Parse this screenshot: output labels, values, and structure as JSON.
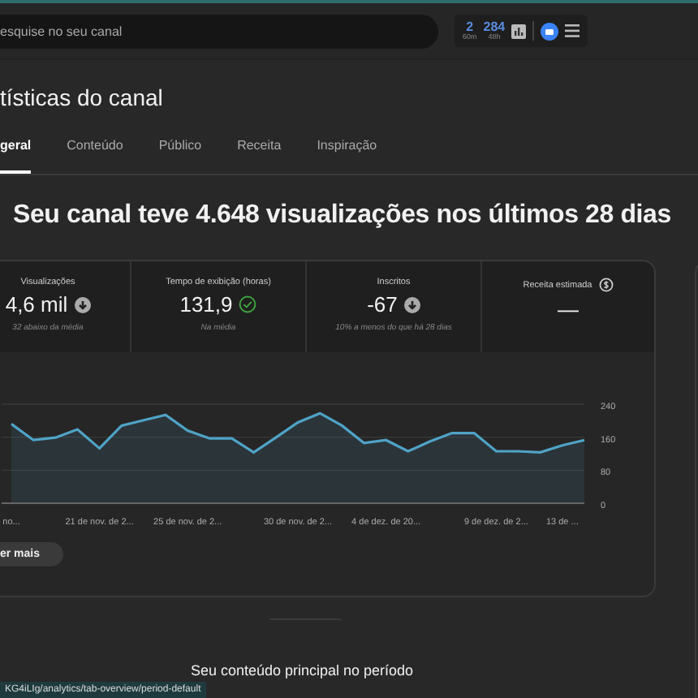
{
  "topbar": {
    "search": {
      "placeholder": "esquise no seu canal"
    },
    "counters": [
      {
        "value": "2",
        "unit": "60m"
      },
      {
        "value": "284",
        "unit": "48h"
      }
    ]
  },
  "page_title": "tísticas do canal",
  "tabs": [
    {
      "label": "geral",
      "selected": true
    },
    {
      "label": "Conteúdo",
      "selected": false
    },
    {
      "label": "Público",
      "selected": false
    },
    {
      "label": "Receita",
      "selected": false
    },
    {
      "label": "Inspiração",
      "selected": false
    }
  ],
  "headline": "Seu canal teve 4.648 visualizações nos últimos 28 dias",
  "metrics": [
    {
      "label": "Visualizações",
      "value": "4,6 mil",
      "kind": "down",
      "note": "32 abaixo da média"
    },
    {
      "label": "Tempo de exibição (horas)",
      "value": "131,9",
      "kind": "ok",
      "note": "Na média"
    },
    {
      "label": "Inscritos",
      "value": "-67",
      "kind": "down",
      "note": "10% a menos do que há 28 dias"
    },
    {
      "label": "Receita estimada",
      "value": "—",
      "kind": "money"
    }
  ],
  "chart_data": {
    "type": "area",
    "categories": [
      "no...",
      null,
      null,
      null,
      "21 de nov. de 2...",
      null,
      null,
      null,
      "25 de nov. de 2...",
      null,
      null,
      null,
      null,
      "30 de nov. de 2...",
      null,
      null,
      null,
      "4 de dez. de 20...",
      null,
      null,
      null,
      null,
      "9 de dez. de 2...",
      null,
      null,
      "13 de ...",
      null
    ],
    "series": [
      {
        "color": "#4fa3c7",
        "values": [
          192,
          153,
          159,
          179,
          133,
          188,
          201,
          214,
          176,
          157,
          157,
          123,
          159,
          196,
          218,
          188,
          146,
          153,
          126,
          150,
          170,
          170,
          126,
          126,
          123,
          140,
          153
        ]
      }
    ],
    "ylim": [
      0,
      240
    ],
    "yticks": [
      0,
      80,
      160,
      240
    ]
  },
  "more_button": "er mais",
  "section_title": "Seu conteúdo principal no período",
  "status_link": "KG4iLIg/analytics/tab-overview/period-default"
}
